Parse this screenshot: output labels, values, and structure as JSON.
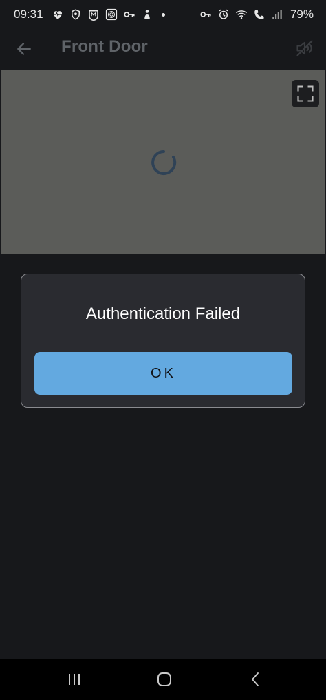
{
  "status_bar": {
    "time": "09:31",
    "battery": "79%",
    "left_icons": [
      "heart-pulse-icon",
      "shield-icon",
      "m-badge-icon",
      "fingerprint-icon",
      "key-icon",
      "person-icon"
    ],
    "right_icons": [
      "key-icon",
      "alarm-icon",
      "wifi-icon",
      "call-icon",
      "signal-icon"
    ]
  },
  "app_bar": {
    "title": "Front Door",
    "back_icon": "arrow-left-icon",
    "mute_icon": "speaker-muted-icon"
  },
  "video": {
    "background": "#5b5c59",
    "loading": true,
    "fullscreen_icon": "fullscreen-icon"
  },
  "dialog": {
    "title": "Authentication Failed",
    "ok_label": "OK"
  },
  "colors": {
    "background": "#17181b",
    "dialog": "#2a2b30",
    "accent": "#63a9e0"
  },
  "nav_bar": {
    "icons": [
      "recents-icon",
      "home-icon",
      "back-icon"
    ]
  }
}
